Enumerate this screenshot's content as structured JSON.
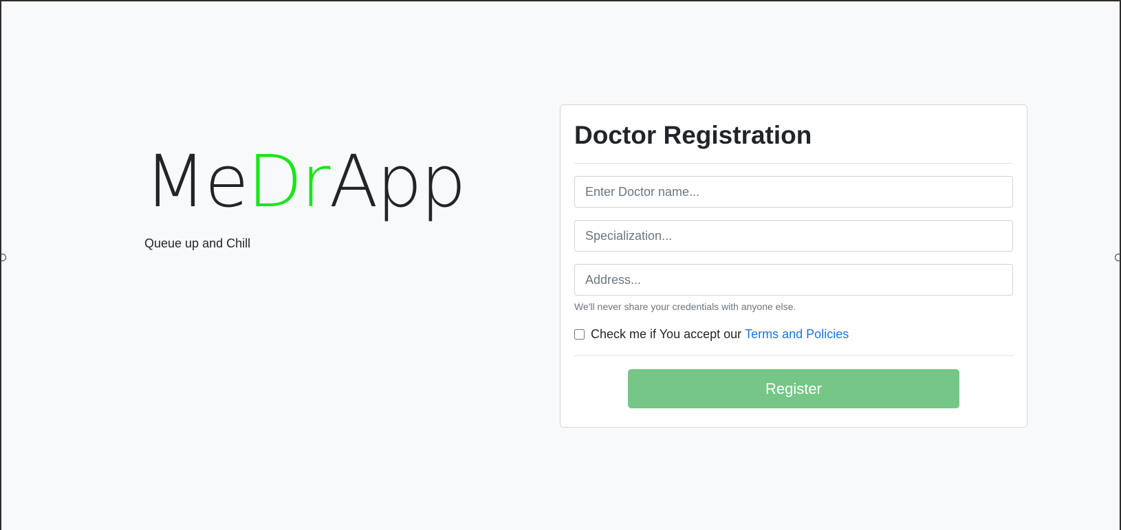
{
  "brand": {
    "title_part1": "Me",
    "title_accent": "Dr",
    "title_part2": "App",
    "tagline": "Queue up and Chill"
  },
  "form": {
    "title": "Doctor Registration",
    "name_placeholder": "Enter Doctor name...",
    "specialization_placeholder": "Specialization...",
    "address_placeholder": "Address...",
    "help_text": "We'll never share your credentials with anyone else.",
    "checkbox_label": "Check me if You accept our",
    "terms_link": "Terms and Policies",
    "register_label": "Register"
  },
  "colors": {
    "accent_green": "#19e619",
    "register_button": "#75c687",
    "link_blue": "#1a73e8",
    "background": "#f8f9fa"
  }
}
